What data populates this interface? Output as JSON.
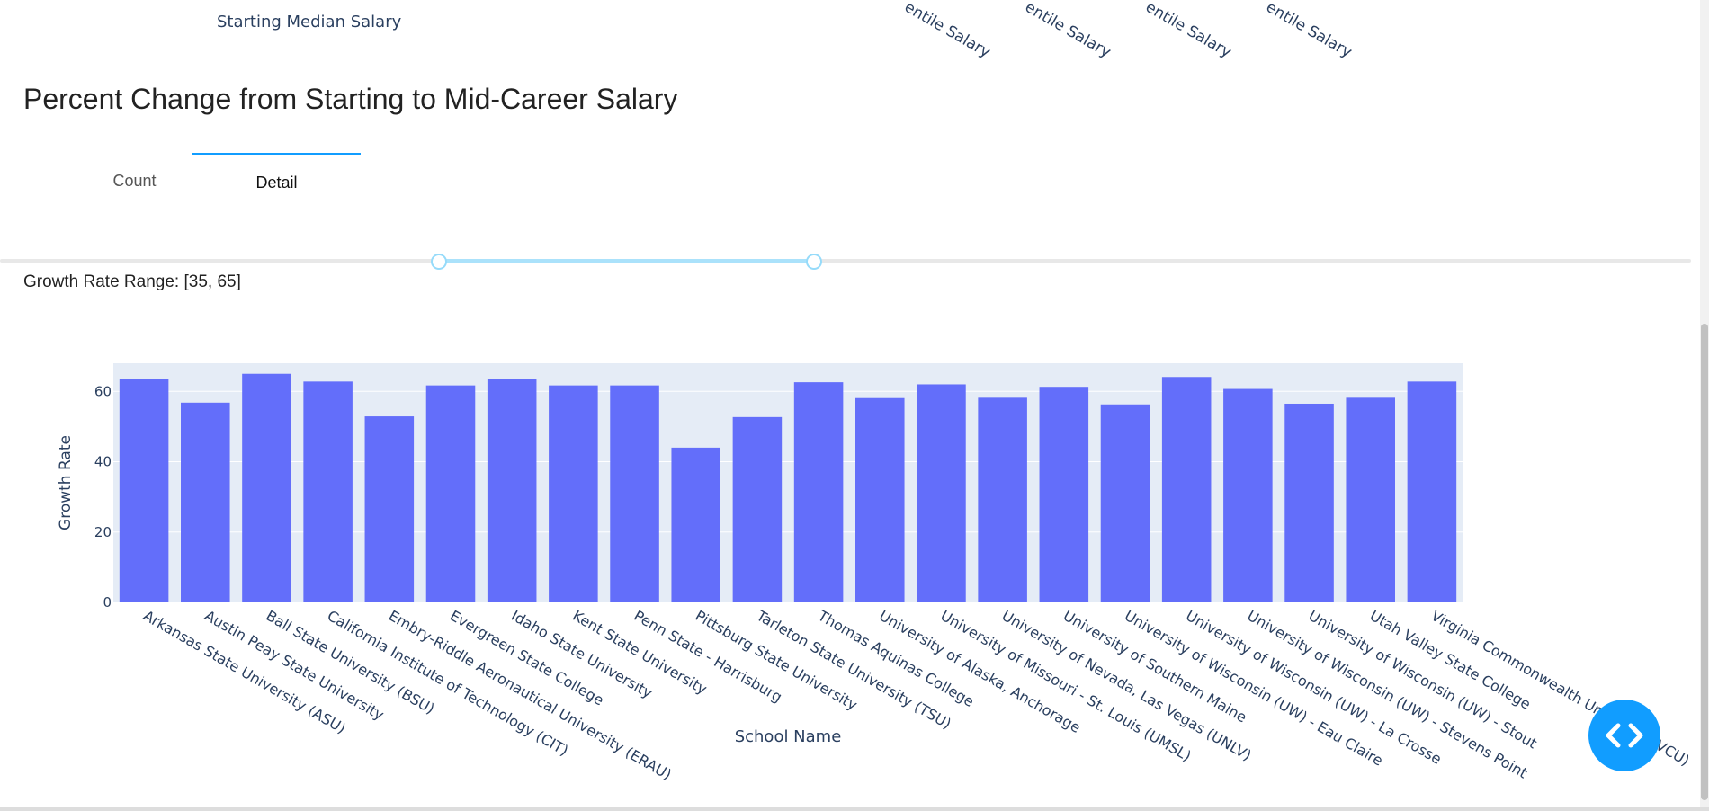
{
  "top_partial": {
    "axis_title": "Starting Median Salary",
    "tick_fragments": [
      "entile Salary",
      "entile Salary",
      "entile Salary",
      "entile Salary"
    ]
  },
  "section_title": "Percent Change from Starting to Mid-Career Salary",
  "tabs": [
    {
      "label": "Count",
      "active": false
    },
    {
      "label": "Detail",
      "active": true
    }
  ],
  "slider": {
    "label": "Growth Rate Range: [35, 65]",
    "low": 35,
    "high": 65,
    "min_fraction_low": 0.262,
    "min_fraction_high": 0.483,
    "accent": "#119dff"
  },
  "chart_data": {
    "type": "bar",
    "xlabel": "School Name",
    "ylabel": "Growth Rate",
    "ylim": [
      0,
      68
    ],
    "yticks": [
      0,
      20,
      40,
      60
    ],
    "grid": true,
    "bar_color": "#636efa",
    "plot_bg": "#e5ecf6",
    "categories": [
      "Arkansas State University (ASU)",
      "Austin Peay State University",
      "Ball State University (BSU)",
      "California Institute of Technology (CIT)",
      "Embry-Riddle Aeronautical University (ERAU)",
      "Evergreen State College",
      "Idaho State University",
      "Kent State University",
      "Penn State - Harrisburg",
      "Pittsburg State University",
      "Tarleton State University (TSU)",
      "Thomas Aquinas College",
      "University of Alaska, Anchorage",
      "University of Missouri - St. Louis (UMSL)",
      "University of Nevada, Las Vegas (UNLV)",
      "University of Southern Maine",
      "University of Wisconsin (UW) - Eau Claire",
      "University of Wisconsin (UW) - La Crosse",
      "University of Wisconsin (UW) - Stevens Point",
      "University of Wisconsin (UW) - Stout",
      "Utah Valley State College",
      "Virginia Commonwealth University (VCU)"
    ],
    "values": [
      63.5,
      56.8,
      65.0,
      62.8,
      52.9,
      61.7,
      63.4,
      61.7,
      61.7,
      44.0,
      52.7,
      62.6,
      58.1,
      62.0,
      58.2,
      61.3,
      56.3,
      64.1,
      60.7,
      56.5,
      58.2,
      62.8
    ]
  },
  "fab": {
    "icon": "code-icon"
  }
}
